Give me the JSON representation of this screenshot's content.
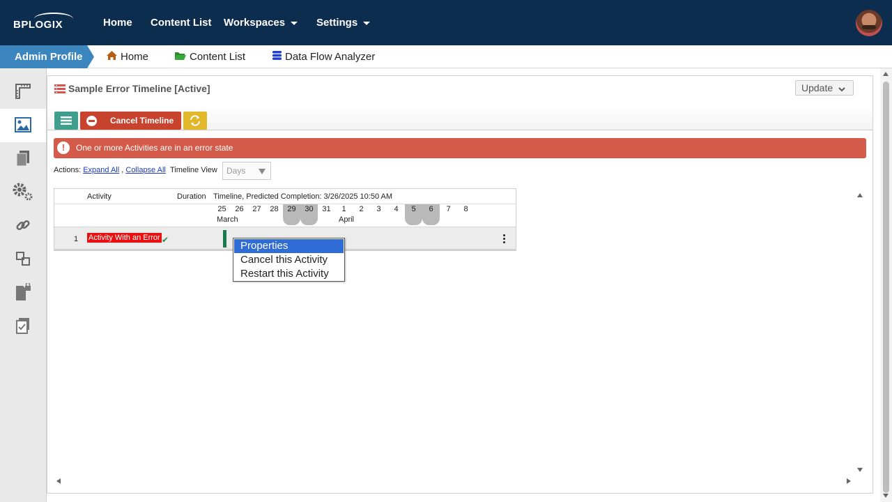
{
  "app": {
    "logo_text": "BPLOGIX"
  },
  "topnav": {
    "items": [
      {
        "label": "Home"
      },
      {
        "label": "Content List"
      },
      {
        "label": "Workspaces"
      },
      {
        "label": "Settings"
      }
    ]
  },
  "breadcrumb": {
    "profile_tab": "Admin Profile",
    "items": [
      {
        "label": "Home",
        "icon": "home-icon"
      },
      {
        "label": "Content List",
        "icon": "folder-open-icon"
      },
      {
        "label": "Data Flow Analyzer",
        "icon": "database-icon"
      }
    ]
  },
  "sidebar": {
    "items": [
      {
        "icon": "ruler-icon"
      },
      {
        "icon": "image-icon",
        "active": true
      },
      {
        "icon": "documents-icon"
      },
      {
        "icon": "gears-icon"
      },
      {
        "icon": "link-icon"
      },
      {
        "icon": "transfer-icon"
      },
      {
        "icon": "locked-document-icon"
      },
      {
        "icon": "checklist-icon"
      }
    ]
  },
  "panel": {
    "title": "Sample Error Timeline [Active]",
    "update_label": "Update",
    "toolbar": {
      "cancel_label": "Cancel Timeline"
    },
    "alert": "One or more Activities are in an error state",
    "actions": {
      "label": "Actions:",
      "expand": "Expand All",
      "separator": ",",
      "collapse": "Collapse All",
      "timeline_view_label": "Timeline View",
      "timeline_view_value": "Days"
    },
    "grid": {
      "headers": {
        "activity": "Activity",
        "duration": "Duration",
        "timeline": "Timeline, Predicted Completion: 3/26/2025 10:50 AM"
      },
      "days": [
        {
          "d": "25",
          "weekend": false
        },
        {
          "d": "26",
          "weekend": false
        },
        {
          "d": "27",
          "weekend": false
        },
        {
          "d": "28",
          "weekend": false
        },
        {
          "d": "29",
          "weekend": true
        },
        {
          "d": "30",
          "weekend": true
        },
        {
          "d": "31",
          "weekend": false
        },
        {
          "d": "1",
          "weekend": false
        },
        {
          "d": "2",
          "weekend": false
        },
        {
          "d": "3",
          "weekend": false
        },
        {
          "d": "4",
          "weekend": false
        },
        {
          "d": "5",
          "weekend": true
        },
        {
          "d": "6",
          "weekend": true
        },
        {
          "d": "7",
          "weekend": false
        },
        {
          "d": "8",
          "weekend": false
        }
      ],
      "months": [
        "March",
        "April"
      ],
      "rows": [
        {
          "num": "1",
          "activity": "Activity With an Error",
          "status_icon": "check-icon"
        }
      ]
    }
  },
  "context_menu": {
    "items": [
      {
        "label": "Properties",
        "selected": true
      },
      {
        "label": "Cancel this Activity",
        "selected": false
      },
      {
        "label": "Restart this Activity",
        "selected": false
      }
    ]
  },
  "colors": {
    "nav_bg": "#0c2d4e",
    "profile_tab": "#3c86c0",
    "alert": "#d35b4a",
    "cancel_button": "#c8432e",
    "menu_button": "#3f9e8c",
    "refresh_button": "#e3b72a",
    "error_activity": "#e81010",
    "menu_selection": "#2f6cd6"
  }
}
